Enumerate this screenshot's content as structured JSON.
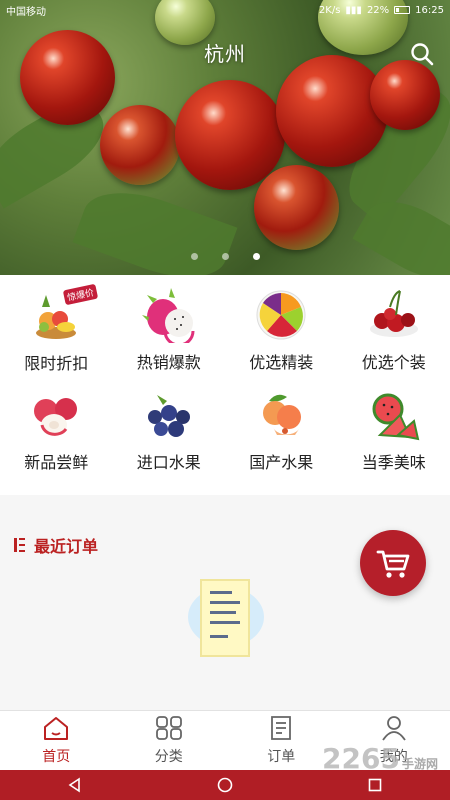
{
  "status": {
    "carrier": "中国移动",
    "speed": "2K/s",
    "battery": "22%",
    "time": "16:25"
  },
  "header": {
    "city": "杭州"
  },
  "banner": {
    "slides": 3,
    "active_slide": 3
  },
  "categories": [
    {
      "label": "限时折扣",
      "icon": "fruit-basket-icon",
      "tag": "惊爆价"
    },
    {
      "label": "热销爆款",
      "icon": "dragon-fruit-icon"
    },
    {
      "label": "优选精装",
      "icon": "fruit-platter-icon"
    },
    {
      "label": "优选个装",
      "icon": "cherries-icon"
    },
    {
      "label": "新品尝鲜",
      "icon": "lychee-icon"
    },
    {
      "label": "进口水果",
      "icon": "blueberries-icon"
    },
    {
      "label": "国产水果",
      "icon": "peaches-icon"
    },
    {
      "label": "当季美味",
      "icon": "watermelon-icon"
    }
  ],
  "orders": {
    "title": "最近订单"
  },
  "tabs": [
    {
      "label": "首页",
      "icon": "home-icon",
      "active": true
    },
    {
      "label": "分类",
      "icon": "category-grid-icon",
      "active": false
    },
    {
      "label": "订单",
      "icon": "order-document-icon",
      "active": false
    },
    {
      "label": "我的",
      "icon": "user-icon",
      "active": false
    }
  ],
  "watermark": {
    "text": "2265",
    "suffix": "手游网"
  },
  "colors": {
    "accent": "#b22222",
    "cart": "#b51f2a",
    "nav": "#b01e25"
  }
}
